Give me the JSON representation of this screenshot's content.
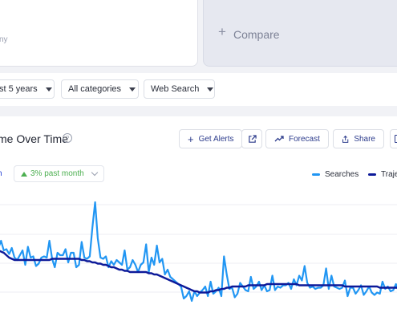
{
  "term_card": {
    "subtitle_fragment": "ny"
  },
  "compare": {
    "label": "Compare",
    "icon": "plus-icon"
  },
  "filters": [
    {
      "label": "st 5 years"
    },
    {
      "label": "All categories"
    },
    {
      "label": "Web Search"
    }
  ],
  "section": {
    "title": "me Over Time",
    "help_icon": "question-circle-icon"
  },
  "actions": {
    "get_alerts": "Get Alerts",
    "forecast": "Forecast",
    "share": "Share"
  },
  "growth": {
    "period_fragment": "h",
    "value": "3% past month",
    "direction": "up"
  },
  "legend": {
    "searches": "Searches",
    "trajectory": "Traje"
  },
  "colors": {
    "accent": "#2a45d6",
    "searches": "#2196f3",
    "trajectory": "#0d1a99",
    "positive": "#4caf50"
  },
  "chart_data": {
    "type": "line",
    "title": "",
    "xlabel": "",
    "ylabel": "",
    "x_range": [
      0,
      120
    ],
    "ylim": [
      0,
      100
    ],
    "grid": true,
    "legend_position": "top-right",
    "series": [
      {
        "name": "Searches",
        "values": [
          54,
          60,
          52,
          53,
          49,
          54,
          46,
          44,
          48,
          52,
          40,
          55,
          46,
          47,
          39,
          41,
          46,
          47,
          46,
          60,
          45,
          38,
          50,
          48,
          48,
          53,
          42,
          50,
          50,
          38,
          40,
          59,
          46,
          45,
          47,
          71,
          92,
          62,
          46,
          45,
          47,
          38,
          43,
          40,
          44,
          42,
          40,
          52,
          36,
          38,
          44,
          40,
          34,
          40,
          42,
          57,
          34,
          46,
          40,
          56,
          42,
          45,
          32,
          36,
          30,
          28,
          26,
          24,
          22,
          12,
          14,
          18,
          10,
          18,
          14,
          17,
          19,
          22,
          14,
          26,
          16,
          18,
          21,
          14,
          47,
          32,
          20,
          21,
          13,
          16,
          25,
          22,
          19,
          18,
          30,
          20,
          22,
          26,
          19,
          23,
          18,
          19,
          31,
          19,
          22,
          21,
          23,
          23,
          25,
          20,
          28,
          23,
          31,
          27,
          39,
          25,
          21,
          22,
          20,
          21,
          21,
          23,
          37,
          20,
          31,
          22,
          21,
          20,
          21,
          27,
          14,
          21,
          21,
          16,
          19,
          23,
          15,
          18,
          22,
          17,
          15,
          17,
          16,
          26,
          20,
          22,
          18,
          19,
          24,
          18
        ]
      },
      {
        "name": "Trajectory",
        "values": [
          52,
          51,
          50,
          48,
          46,
          45,
          44,
          44,
          44,
          44,
          44,
          44,
          44,
          44,
          44,
          44,
          44,
          44,
          44,
          44,
          45,
          45,
          45,
          45,
          45,
          45,
          45,
          45,
          45,
          45,
          45,
          44,
          44,
          43,
          43,
          42,
          42,
          41,
          41,
          40,
          40,
          39,
          38,
          38,
          37,
          36,
          36,
          35,
          35,
          34,
          34,
          34,
          34,
          34,
          34,
          34,
          33,
          33,
          32,
          32,
          31,
          30,
          29,
          28,
          27,
          26,
          25,
          24,
          23,
          22,
          21,
          20,
          19,
          18,
          18,
          17,
          17,
          17,
          17,
          18,
          18,
          19,
          19,
          20,
          20,
          21,
          21,
          22,
          22,
          22,
          22,
          22,
          22,
          23,
          23,
          23,
          23,
          23,
          23,
          23,
          24,
          24,
          24,
          24,
          24,
          24,
          24,
          24,
          24,
          24,
          24,
          24,
          23,
          23,
          23,
          23,
          23,
          23,
          23,
          23,
          23,
          23,
          23,
          23,
          23,
          23,
          23,
          23,
          23,
          22,
          22,
          22,
          22,
          22,
          22,
          22,
          22,
          22,
          22,
          22,
          22,
          22,
          21,
          21,
          21,
          21,
          21,
          21,
          21,
          21
        ]
      }
    ]
  }
}
